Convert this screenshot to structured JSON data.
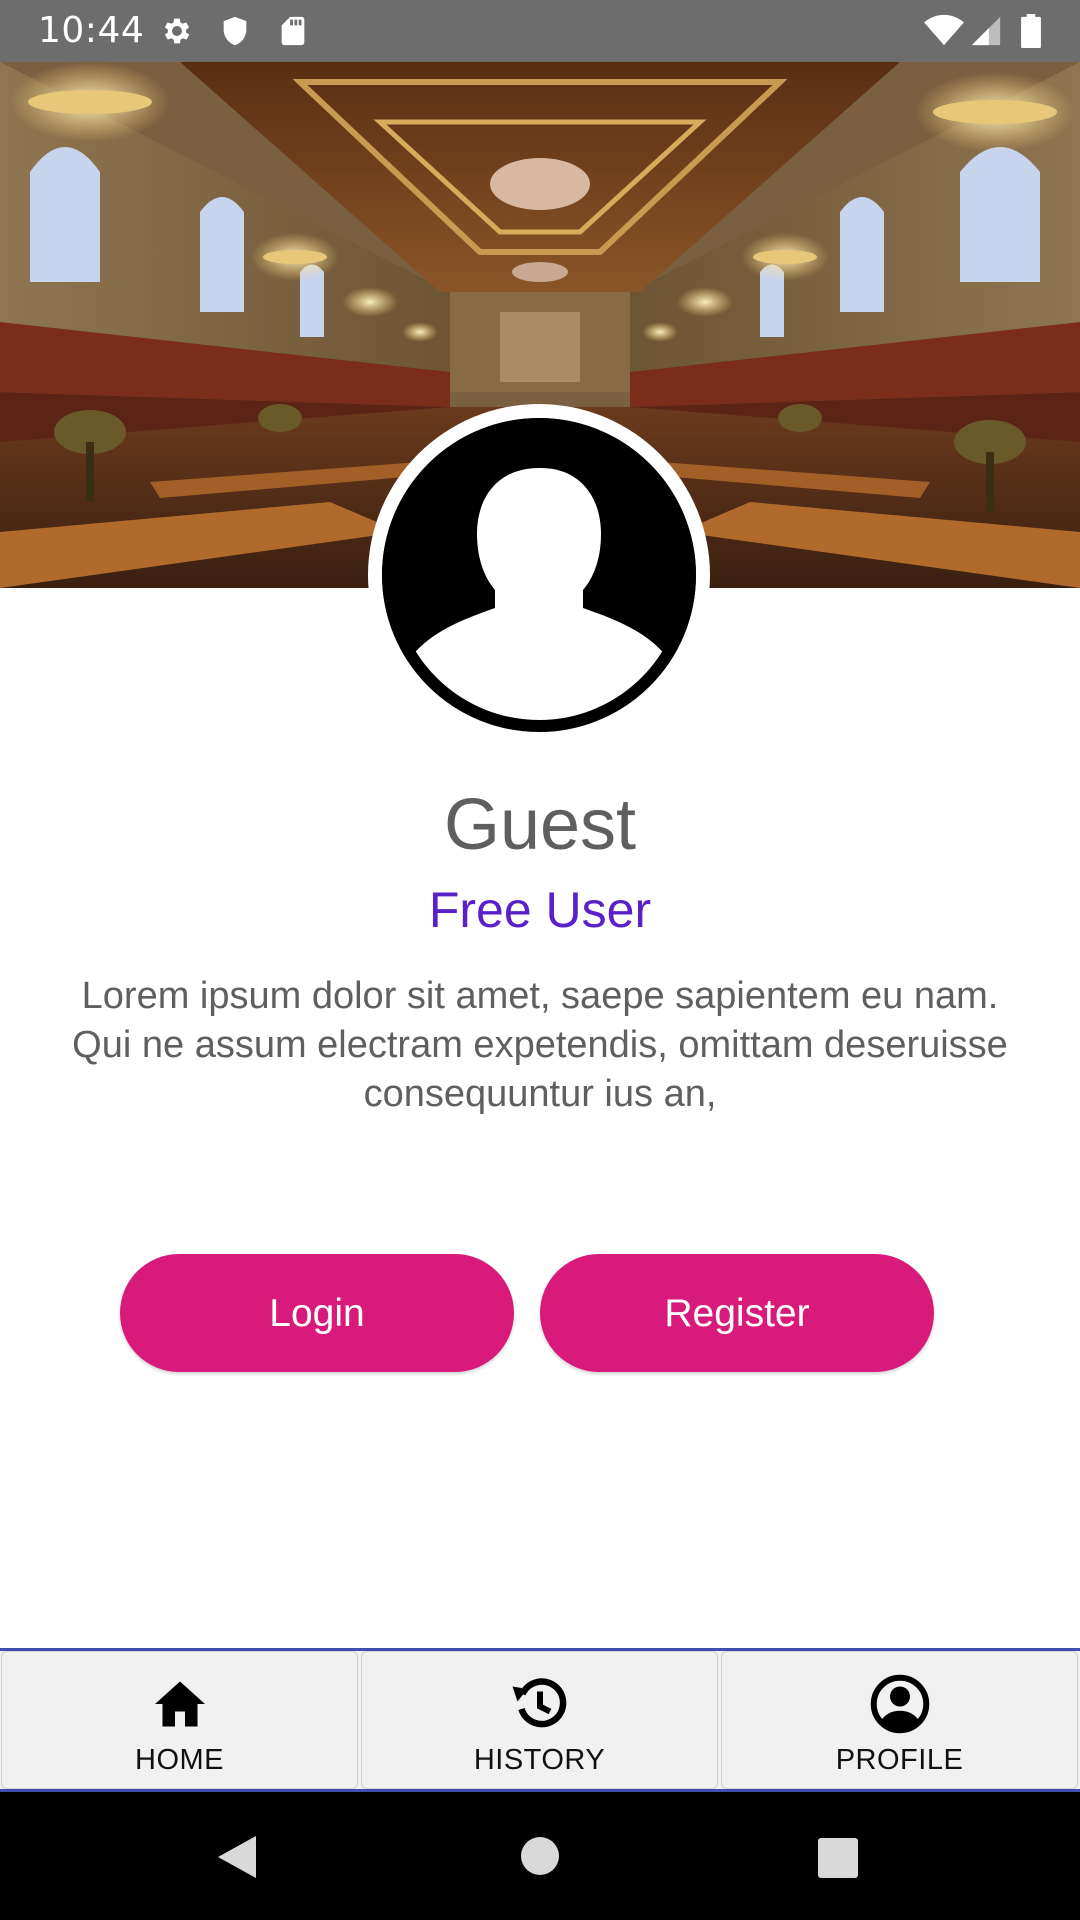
{
  "status_bar": {
    "time": "10:44",
    "icons": [
      "settings-icon",
      "shield-icon",
      "sd-card-icon",
      "wifi-icon",
      "signal-icon",
      "battery-icon"
    ]
  },
  "header": {
    "image": "library-reading-room-photo"
  },
  "profile": {
    "avatar_icon": "person-silhouette-icon",
    "name": "Guest",
    "plan": "Free User",
    "bio": "Lorem ipsum dolor sit amet, saepe sapientem eu nam. Qui ne assum electram expetendis, omittam deseruisse consequuntur ius an,"
  },
  "actions": {
    "login_label": "Login",
    "register_label": "Register"
  },
  "bottom_nav": {
    "items": [
      {
        "label": "HOME",
        "icon": "home-icon"
      },
      {
        "label": "HISTORY",
        "icon": "history-icon"
      },
      {
        "label": "PROFILE",
        "icon": "account-circle-icon"
      }
    ]
  },
  "colors": {
    "accent_button": "#d81b7a",
    "plan_text": "#5a21c9",
    "nav_border": "#3f4db0",
    "status_bar": "#6d6d6d"
  }
}
